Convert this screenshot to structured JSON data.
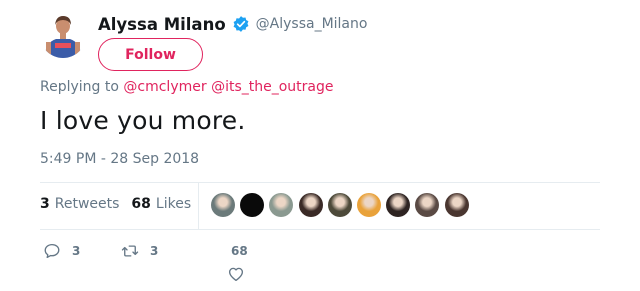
{
  "author": {
    "display_name": "Alyssa Milano",
    "handle": "@Alyssa_Milano",
    "verified": true,
    "verified_color": "#1da1f2"
  },
  "follow_button": {
    "label": "Follow",
    "color": "#e0245e"
  },
  "reply_context": {
    "prefix": "Replying to",
    "mentions": [
      "@cmclymer",
      "@its_the_outrage"
    ]
  },
  "tweet": {
    "text": "I love you more.",
    "timestamp": "5:49 PM - 28 Sep 2018"
  },
  "stats": {
    "retweets_count": "3",
    "retweets_label": "Retweets",
    "likes_count": "68",
    "likes_label": "Likes"
  },
  "liker_avatars": [
    {
      "icon": "liker-avatar",
      "color": "#6b7a7a"
    },
    {
      "icon": "liker-avatar",
      "color": "#0a0a0a"
    },
    {
      "icon": "liker-avatar",
      "color": "#8a9990"
    },
    {
      "icon": "liker-avatar",
      "color": "#3a2a26"
    },
    {
      "icon": "liker-avatar",
      "color": "#4d4a3a"
    },
    {
      "icon": "liker-avatar",
      "color": "#e9a23a"
    },
    {
      "icon": "liker-avatar",
      "color": "#2e2422"
    },
    {
      "icon": "liker-avatar",
      "color": "#5a4a44"
    },
    {
      "icon": "liker-avatar",
      "color": "#4a3630"
    }
  ],
  "actions": {
    "reply_count": "3",
    "retweet_count": "3",
    "like_count": "68"
  },
  "colors": {
    "accent": "#e0245e",
    "secondary_text": "#657786",
    "primary_text": "#14171a",
    "border": "#e6ecf0"
  }
}
